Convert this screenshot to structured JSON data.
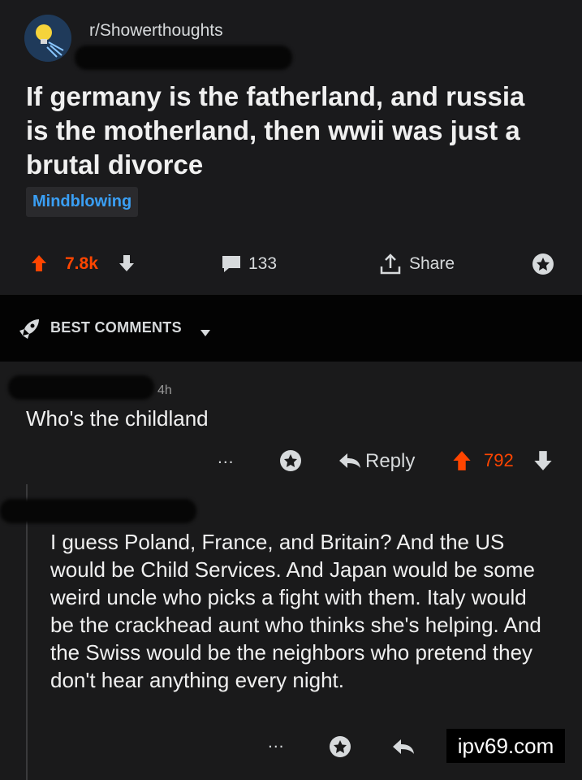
{
  "post": {
    "subreddit": "r/Showerthoughts",
    "title": "If germany is the fatherland, and russia is the motherland, then wwii was just a brutal divorce",
    "flair": "Mindblowing",
    "votes": "7.8k",
    "comments": "133",
    "share_label": "Share"
  },
  "best_comments": {
    "label": "BEST COMMENTS"
  },
  "comment": {
    "time": "4h",
    "text": "Who's the childland",
    "more": "...",
    "reply_label": "Reply",
    "votes": "792"
  },
  "reply": {
    "text": "I guess Poland, France, and Britain? And the US would be Child Services. And Japan would be some weird uncle who picks a fight with them. Italy would be the crackhead aunt who thinks she's helping. And the Swiss would be the neighbors who pretend they don't hear anything every night.",
    "more": "..."
  },
  "watermark": "ipv69.com",
  "colors": {
    "upvote": "#ff4500",
    "flair": "#3a9ff5",
    "background": "#1a1a1b"
  },
  "icons": [
    "subreddit-avatar-icon",
    "upvote-icon",
    "downvote-icon",
    "comment-icon",
    "share-icon",
    "award-icon",
    "rocket-icon",
    "caret-down-icon",
    "reply-arrow-icon"
  ]
}
